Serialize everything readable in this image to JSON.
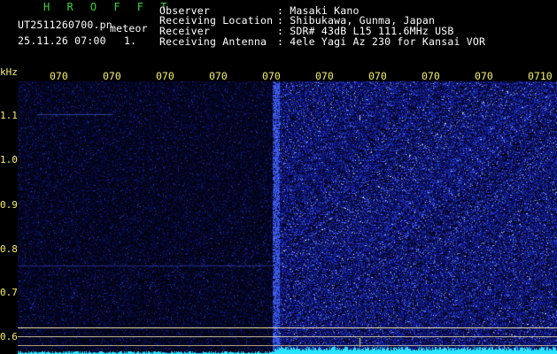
{
  "header": {
    "program": "H R O F F T",
    "filename": "UT2511260700.pn",
    "mode": "meteor",
    "datetime": "25.11.26 07:00",
    "count": "1.",
    "fields": [
      {
        "label": "Observer",
        "value": ": Masaki Kano"
      },
      {
        "label": "Receiving Location",
        "value": ": Shibukawa, Gunma, Japan"
      },
      {
        "label": "Receiver",
        "value": ": SDR# 43dB L15 111.6MHz USB"
      },
      {
        "label": "Receiving Antenna",
        "value": ": 4ele Yagi Az 230 for Kansai VOR"
      }
    ]
  },
  "axis": {
    "unit": "kHz",
    "freq_labels": [
      "1.1",
      "1.0",
      "0.9",
      "0.8",
      "0.7",
      "0.6"
    ],
    "time_labels": [
      "070",
      "070",
      "070",
      "070",
      "070",
      "070",
      "070",
      "070",
      "070",
      "070",
      "0710"
    ]
  },
  "colors": {
    "background": "#000000",
    "spectrum_dark": "#03041a",
    "noise": "#2a3fd8",
    "noise_bright": "#7f95ff",
    "signal": "#29e3ff",
    "reference_line": "#d8d3a0",
    "marker": "#e8e26a"
  }
}
